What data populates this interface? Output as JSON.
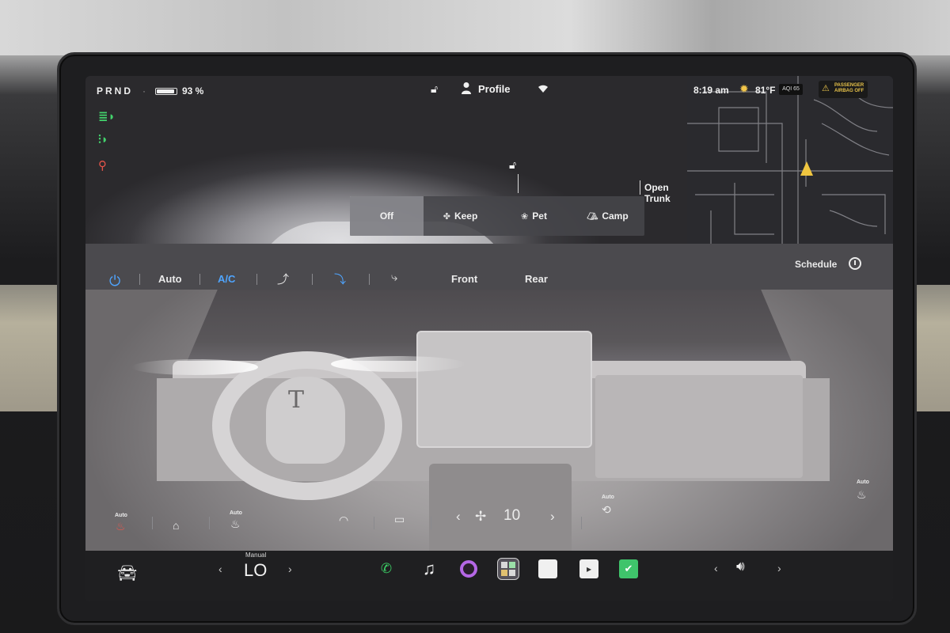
{
  "status": {
    "gear": "PRND",
    "separator": "·",
    "battery_percent": "93 %",
    "battery_level": 0.93,
    "profile_label": "Profile",
    "time": "8:19 am",
    "temperature": "81°F",
    "aqi_badge": "AQI 65",
    "airbag_text": "PASSENGER AIRBAG OFF"
  },
  "telltales": {
    "low_beam_icon": "low-beam-headlights-icon",
    "fog_icon": "fog-lights-icon",
    "seatbelt_icon": "seatbelt-warning-icon"
  },
  "vehicle": {
    "open_trunk": "Open Trunk",
    "climate_modes": [
      {
        "label": "Off",
        "icon": "",
        "active": true
      },
      {
        "label": "Keep",
        "icon": "fan-icon",
        "active": false
      },
      {
        "label": "Pet",
        "icon": "paw-icon",
        "active": false
      },
      {
        "label": "Camp",
        "icon": "tent-icon",
        "active": false
      }
    ]
  },
  "climate": {
    "auto_label": "Auto",
    "ac_label": "A/C",
    "front_label": "Front",
    "rear_label": "Rear",
    "schedule_label": "Schedule",
    "fan_speed": "10",
    "seat_heat_auto": "Auto",
    "steering_heat_auto": "Auto",
    "recirc_auto": "Auto",
    "right_seat_auto": "Auto"
  },
  "dock": {
    "temp_mode": "Manual",
    "temp_value": "LO",
    "chevron_left": "‹",
    "chevron_right": "›"
  },
  "colors": {
    "accent_blue": "#4fa5ff",
    "telltale_green": "#43d26c",
    "warning_red": "#e5544a",
    "nav_yellow": "#f0c640"
  }
}
